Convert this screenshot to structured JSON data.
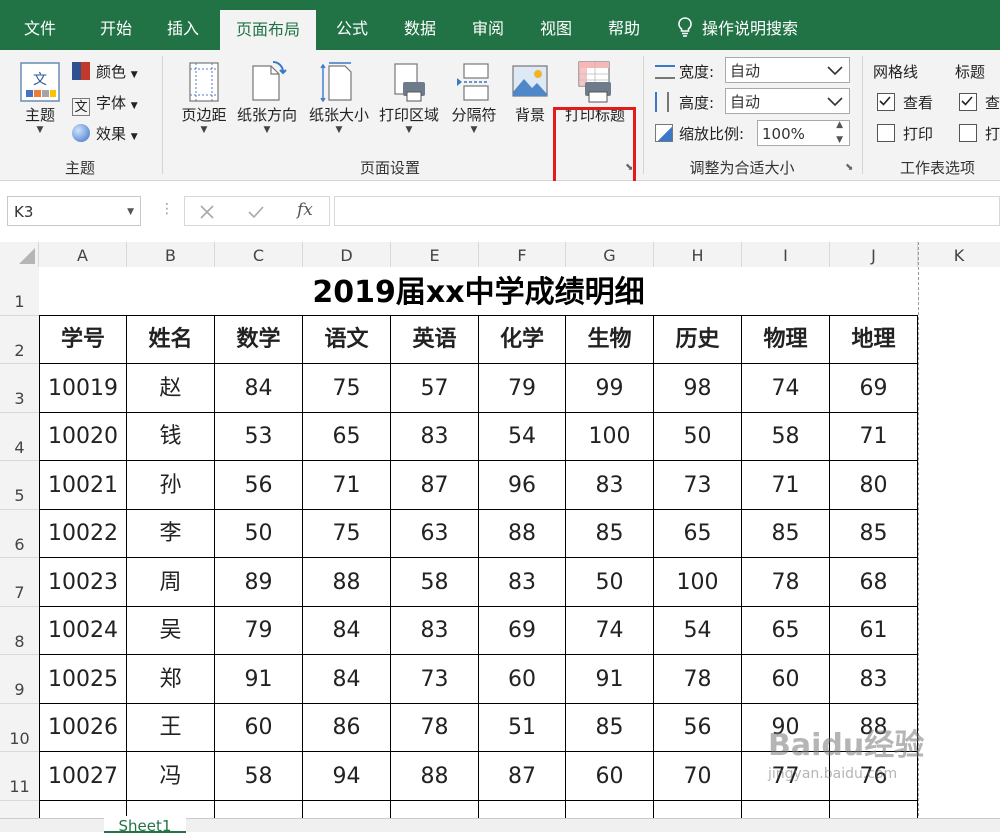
{
  "menu": {
    "tabs": [
      "文件",
      "开始",
      "插入",
      "页面布局",
      "公式",
      "数据",
      "审阅",
      "视图",
      "帮助"
    ],
    "active": "页面布局",
    "search": "操作说明搜索"
  },
  "ribbon": {
    "theme_group": {
      "theme": "主题",
      "colors": "颜色",
      "fonts": "字体",
      "effects": "效果",
      "label": "主题"
    },
    "page_setup": {
      "margins": "页边距",
      "orientation": "纸张方向",
      "size": "纸张大小",
      "print_area": "打印区域",
      "breaks": "分隔符",
      "background": "背景",
      "print_titles": "打印标题",
      "label": "页面设置"
    },
    "scale": {
      "width_label": "宽度:",
      "width_value": "自动",
      "height_label": "高度:",
      "height_value": "自动",
      "scale_label": "缩放比例:",
      "scale_value": "100%",
      "label": "调整为合适大小"
    },
    "sheet_options": {
      "gridlines": "网格线",
      "headings": "标题",
      "view": "查看",
      "view2": "查",
      "print": "打印",
      "print2": "打",
      "label": "工作表选项"
    }
  },
  "formula_bar": {
    "namebox": "K3",
    "fx": "fx",
    "value": ""
  },
  "columns": [
    "A",
    "B",
    "C",
    "D",
    "E",
    "F",
    "G",
    "H",
    "I",
    "J",
    "K"
  ],
  "rows": [
    "1",
    "2",
    "3",
    "4",
    "5",
    "6",
    "7",
    "8",
    "9",
    "10",
    "11"
  ],
  "sheet": {
    "title": "2019届xx中学成绩明细",
    "headers": [
      "学号",
      "姓名",
      "数学",
      "语文",
      "英语",
      "化学",
      "生物",
      "历史",
      "物理",
      "地理"
    ],
    "data": [
      [
        "10019",
        "赵",
        "84",
        "75",
        "57",
        "79",
        "99",
        "98",
        "74",
        "69"
      ],
      [
        "10020",
        "钱",
        "53",
        "65",
        "83",
        "54",
        "100",
        "50",
        "58",
        "71"
      ],
      [
        "10021",
        "孙",
        "56",
        "71",
        "87",
        "96",
        "83",
        "73",
        "71",
        "80"
      ],
      [
        "10022",
        "李",
        "50",
        "75",
        "63",
        "88",
        "85",
        "65",
        "85",
        "85"
      ],
      [
        "10023",
        "周",
        "89",
        "88",
        "58",
        "83",
        "50",
        "100",
        "78",
        "68"
      ],
      [
        "10024",
        "吴",
        "79",
        "84",
        "83",
        "69",
        "74",
        "54",
        "65",
        "61"
      ],
      [
        "10025",
        "郑",
        "91",
        "84",
        "73",
        "60",
        "91",
        "78",
        "60",
        "83"
      ],
      [
        "10026",
        "王",
        "60",
        "86",
        "78",
        "51",
        "85",
        "56",
        "90",
        "88"
      ],
      [
        "10027",
        "冯",
        "58",
        "94",
        "88",
        "87",
        "60",
        "70",
        "77",
        "76"
      ]
    ]
  },
  "sheet_tab": "Sheet1",
  "watermark": {
    "brand": "Baidu经验",
    "url": "jingyan.baidu.com"
  }
}
